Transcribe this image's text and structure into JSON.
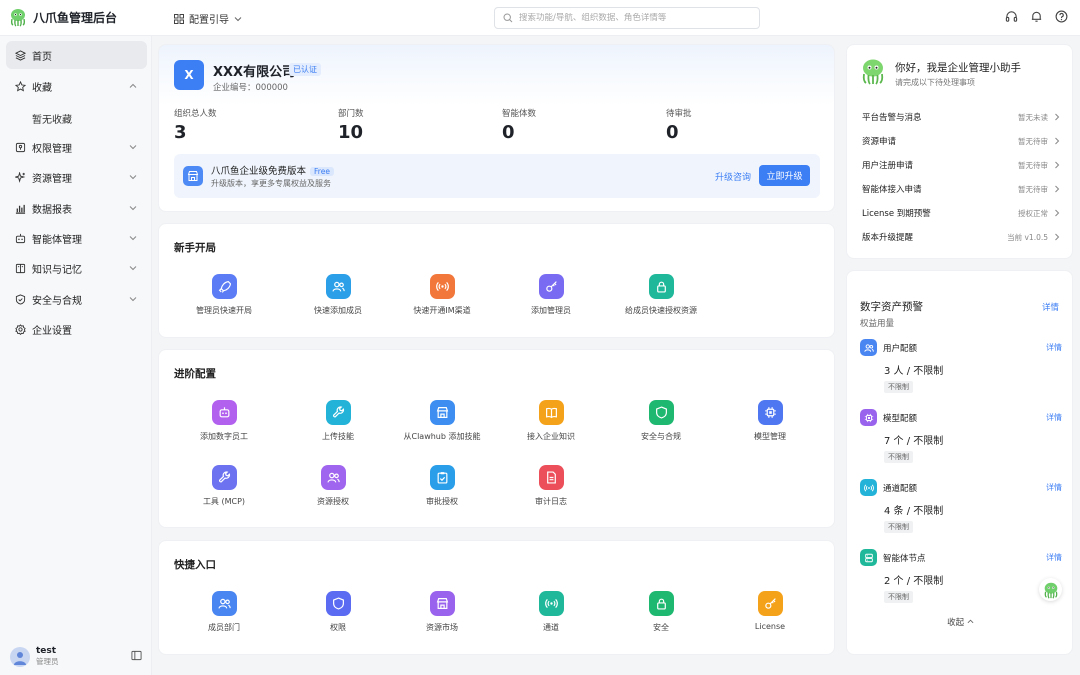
{
  "app": {
    "title": "八爪鱼管理后台"
  },
  "header": {
    "guide_label": "配置引导",
    "search_placeholder": "搜索功能/导航、组织数据、角色详情等"
  },
  "sidebar": {
    "items": [
      {
        "label": "首页",
        "icon": "layers-icon"
      },
      {
        "label": "收藏",
        "icon": "star-icon"
      },
      {
        "label": "权限管理",
        "icon": "key-icon"
      },
      {
        "label": "资源管理",
        "icon": "sparkle-icon"
      },
      {
        "label": "数据报表",
        "icon": "chart-icon"
      },
      {
        "label": "智能体管理",
        "icon": "robot-icon"
      },
      {
        "label": "知识与记忆",
        "icon": "book-icon"
      },
      {
        "label": "安全与合规",
        "icon": "shield-icon"
      },
      {
        "label": "企业设置",
        "icon": "gear-icon"
      }
    ],
    "favorites_empty": "暂无收藏",
    "user": {
      "name": "test",
      "role": "管理员"
    }
  },
  "company": {
    "logo_letter": "X",
    "name": "XXX有限公司",
    "badge": "已认证",
    "id_label": "企业编号：000000",
    "stats": [
      {
        "label": "组织总人数",
        "value": "3"
      },
      {
        "label": "部门数",
        "value": "10"
      },
      {
        "label": "智能体数",
        "value": "0"
      },
      {
        "label": "待审批",
        "value": "0"
      }
    ],
    "banner": {
      "title": "八爪鱼企业级免费版本",
      "free": "Free",
      "subtitle": "升级版本，享更多专属权益及服务",
      "consult": "升级咨询",
      "upgrade": "立即升级"
    }
  },
  "starter": {
    "title": "新手开局",
    "items": [
      {
        "label": "管理员快速开局",
        "icon": "rocket-icon",
        "color": "#5b7cf5"
      },
      {
        "label": "快速添加成员",
        "icon": "users-icon",
        "color": "#2b9fe8"
      },
      {
        "label": "快速开通IM渠道",
        "icon": "signal-icon",
        "color": "#f2773a"
      },
      {
        "label": "添加管理员",
        "icon": "key-icon",
        "color": "#7a6cf2"
      },
      {
        "label": "给成员快速授权资源",
        "icon": "lock-icon",
        "color": "#1fb89a"
      }
    ]
  },
  "advanced": {
    "title": "进阶配置",
    "items": [
      {
        "label": "添加数字员工",
        "icon": "robot-icon",
        "color": "#b261ef"
      },
      {
        "label": "上传技能",
        "icon": "wrench-icon",
        "color": "#24b3d8"
      },
      {
        "label": "从Clawhub 添加技能",
        "icon": "store-icon",
        "color": "#3d8ef0"
      },
      {
        "label": "接入企业知识",
        "icon": "book-icon",
        "color": "#f5a21b"
      },
      {
        "label": "安全与合规",
        "icon": "shield-icon",
        "color": "#1fb871"
      },
      {
        "label": "模型管理",
        "icon": "chip-icon",
        "color": "#5077f2"
      },
      {
        "label": "工具 (MCP)",
        "icon": "wrench-icon",
        "color": "#6d72f0"
      },
      {
        "label": "资源授权",
        "icon": "users-icon",
        "color": "#a065ee"
      },
      {
        "label": "审批授权",
        "icon": "clipboard-check-icon",
        "color": "#2a9ee8"
      },
      {
        "label": "审计日志",
        "icon": "file-icon",
        "color": "#ec4f5a"
      }
    ]
  },
  "shortcuts": {
    "title": "快捷入口",
    "items": [
      {
        "label": "成员部门",
        "icon": "users-icon",
        "color": "#4a86f2"
      },
      {
        "label": "权限",
        "icon": "shield-icon",
        "color": "#5b6cf2"
      },
      {
        "label": "资源市场",
        "icon": "store-icon",
        "color": "#9a63ee"
      },
      {
        "label": "通道",
        "icon": "signal-icon",
        "color": "#1fb89a"
      },
      {
        "label": "安全",
        "icon": "lock-icon",
        "color": "#1fb871"
      },
      {
        "label": "License",
        "icon": "key-icon",
        "color": "#f5a21b"
      }
    ]
  },
  "assistant": {
    "title": "你好，我是企业管理小助手",
    "subtitle": "请完成以下待处理事项",
    "todos": [
      {
        "label": "平台告警与消息",
        "status": "暂无未读"
      },
      {
        "label": "资源申请",
        "status": "暂无待审"
      },
      {
        "label": "用户注册申请",
        "status": "暂无待审"
      },
      {
        "label": "智能体接入申请",
        "status": "暂无待审"
      },
      {
        "label": "License 到期预警",
        "status": "授权正常"
      },
      {
        "label": "版本升级提醒",
        "status": "当前 v1.0.5"
      }
    ]
  },
  "assets": {
    "title": "数字资产预警",
    "detail": "详情",
    "subtitle": "权益用量",
    "collapse": "收起",
    "quotas": [
      {
        "label": "用户配额",
        "value": "3 人 / 不限制",
        "tag": "不限制",
        "link": "详情",
        "icon": "users-icon",
        "color": "#4a86f2"
      },
      {
        "label": "模型配额",
        "value": "7 个 / 不限制",
        "tag": "不限制",
        "link": "详情",
        "icon": "chip-icon",
        "color": "#9a63ee"
      },
      {
        "label": "通道配额",
        "value": "4 条 / 不限制",
        "tag": "不限制",
        "link": "详情",
        "icon": "signal-icon",
        "color": "#24b3d8"
      },
      {
        "label": "智能体节点",
        "value": "2 个 / 不限制",
        "tag": "不限制",
        "link": "详情",
        "icon": "server-icon",
        "color": "#1fb89a"
      }
    ]
  }
}
